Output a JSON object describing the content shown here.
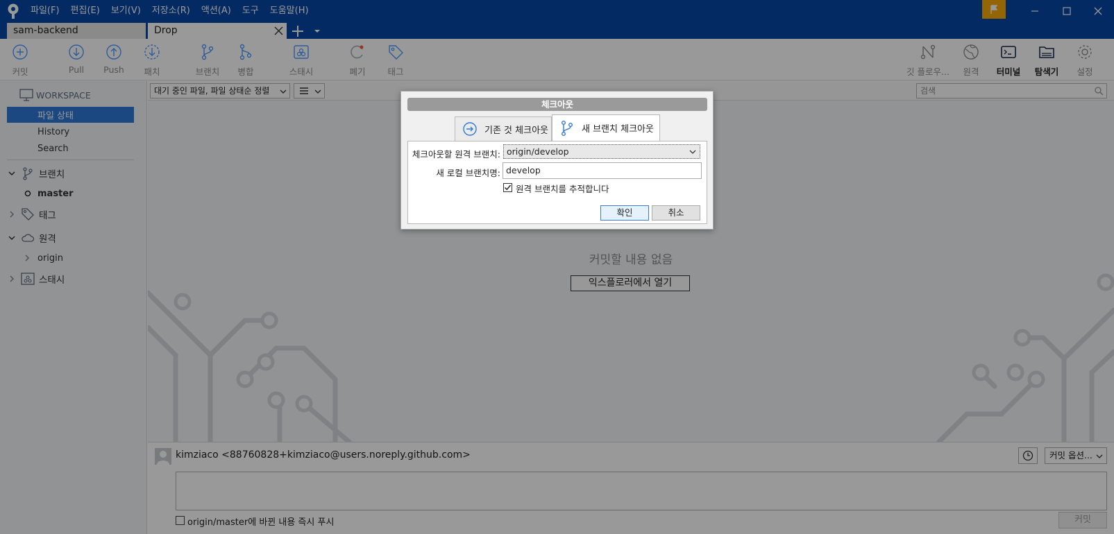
{
  "menu": [
    "파일(F)",
    "편집(E)",
    "보기(V)",
    "저장소(R)",
    "액션(A)",
    "도구",
    "도움말(H)"
  ],
  "tabs": [
    {
      "label": "sam-backend",
      "active": false
    },
    {
      "label": "Drop",
      "active": true
    }
  ],
  "toolbar": {
    "commit": "커밋",
    "pull": "Pull",
    "push": "Push",
    "patch": "패치",
    "branch": "브랜치",
    "merge": "병합",
    "stash": "스태시",
    "discard": "폐기",
    "tag": "태그",
    "gitflow": "깃 플로우...",
    "remote": "원격",
    "terminal": "터미널",
    "explorer": "탐색기",
    "settings": "설정"
  },
  "sidebar": {
    "workspace": "WORKSPACE",
    "file_status": "파일 상태",
    "history": "History",
    "search": "Search",
    "branches": "브랜치",
    "branch_master": "master",
    "tags": "태그",
    "remotes": "원격",
    "remote_origin": "origin",
    "stashes": "스태시"
  },
  "main": {
    "filter": "대기 중인 파일, 파일 상태순 정렬",
    "search_placeholder": "검색",
    "empty": "커밋할 내용 없음",
    "open_explorer": "익스플로러에서 열기"
  },
  "commit": {
    "author": "kimziaco <88760828+kimziaco@users.noreply.github.com>",
    "options": "커밋 옵션...",
    "push_label": "origin/master에 바뀐 내용 즉시 푸시",
    "commit_button": "커밋"
  },
  "dialog": {
    "title": "체크아웃",
    "tab_existing": "기존 것 체크아웃",
    "tab_new": "새 브랜치 체크아웃",
    "remote_label": "체크아웃할 원격 브랜치:",
    "remote_value": "origin/develop",
    "local_label": "새 로컬 브랜치명:",
    "local_value": "develop",
    "track_label": "원격 브랜치를 추적합니다",
    "track_checked": true,
    "ok": "확인",
    "cancel": "취소"
  },
  "colors": {
    "titlebar": "#0747a6",
    "accent": "#2e79d6",
    "flag": "#f7a908"
  }
}
